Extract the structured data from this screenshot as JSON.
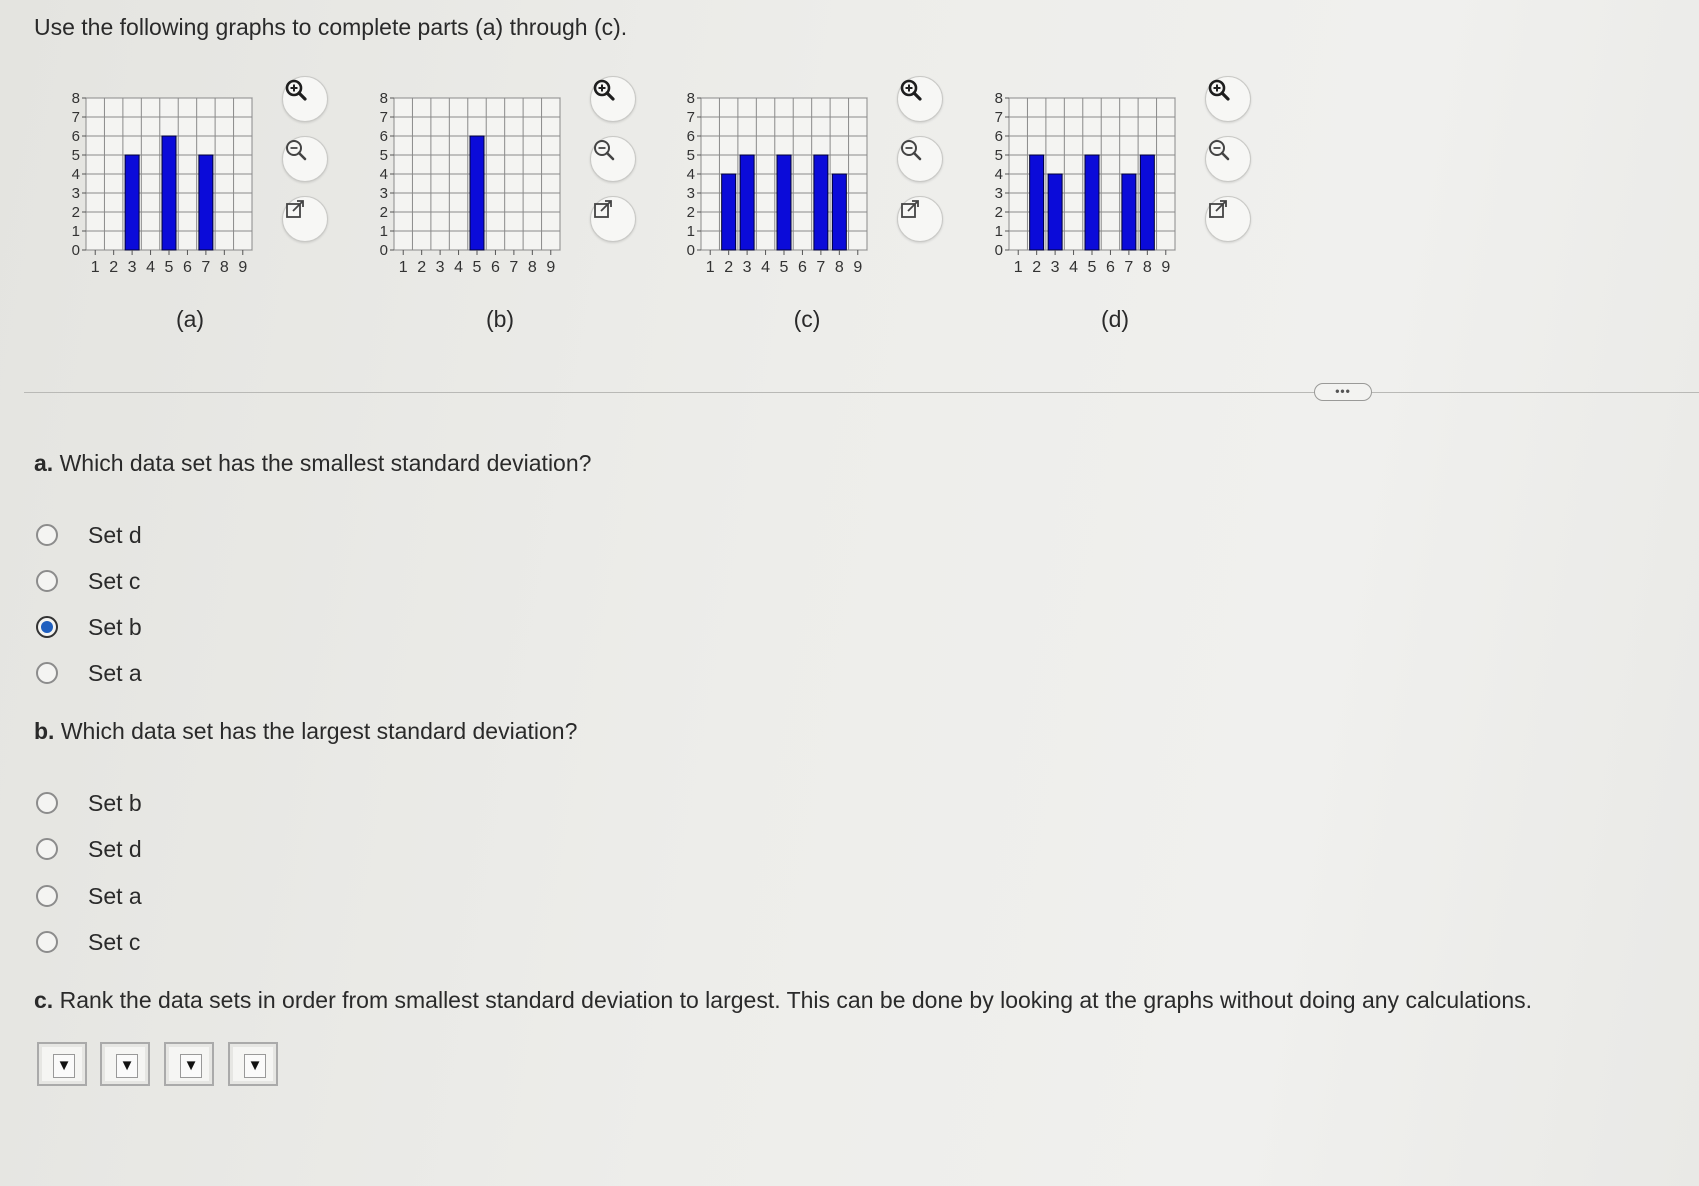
{
  "intro": "Use the following graphs to complete parts (a) through (c).",
  "chart_data": [
    {
      "type": "bar",
      "categories": [
        "1",
        "2",
        "3",
        "4",
        "5",
        "6",
        "7",
        "8",
        "9"
      ],
      "values": [
        0,
        0,
        5,
        0,
        6,
        0,
        5,
        0,
        0
      ],
      "y_ticks": [
        "0",
        "1",
        "2",
        "3",
        "4",
        "5",
        "6",
        "7",
        "8"
      ],
      "ylim": [
        0,
        8
      ],
      "grid": true,
      "caption": "(a)"
    },
    {
      "type": "bar",
      "categories": [
        "1",
        "2",
        "3",
        "4",
        "5",
        "6",
        "7",
        "8",
        "9"
      ],
      "values": [
        0,
        0,
        0,
        0,
        6,
        0,
        0,
        0,
        0
      ],
      "y_ticks": [
        "0",
        "1",
        "2",
        "3",
        "4",
        "5",
        "6",
        "7",
        "8"
      ],
      "ylim": [
        0,
        8
      ],
      "grid": true,
      "caption": "(b)"
    },
    {
      "type": "bar",
      "categories": [
        "1",
        "2",
        "3",
        "4",
        "5",
        "6",
        "7",
        "8",
        "9"
      ],
      "values": [
        0,
        4,
        5,
        0,
        5,
        0,
        5,
        4,
        0
      ],
      "y_ticks": [
        "0",
        "1",
        "2",
        "3",
        "4",
        "5",
        "6",
        "7",
        "8"
      ],
      "ylim": [
        0,
        8
      ],
      "grid": true,
      "caption": "(c)"
    },
    {
      "type": "bar",
      "categories": [
        "1",
        "2",
        "3",
        "4",
        "5",
        "6",
        "7",
        "8",
        "9"
      ],
      "values": [
        0,
        5,
        4,
        0,
        5,
        0,
        4,
        5,
        0
      ],
      "y_ticks": [
        "0",
        "1",
        "2",
        "3",
        "4",
        "5",
        "6",
        "7",
        "8"
      ],
      "ylim": [
        0,
        8
      ],
      "grid": true,
      "caption": "(d)"
    }
  ],
  "icons": [
    "zoom-in-icon",
    "zoom-out-icon",
    "open-external-icon"
  ],
  "more_button": "•••",
  "part_a": {
    "letter": "a.",
    "question": "Which data set has the smallest standard deviation?",
    "options": [
      "Set d",
      "Set c",
      "Set b",
      "Set a"
    ],
    "selected": "Set b"
  },
  "part_b": {
    "letter": "b.",
    "question": "Which data set has the largest standard deviation?",
    "options": [
      "Set b",
      "Set d",
      "Set a",
      "Set c"
    ],
    "selected": null
  },
  "part_c": {
    "letter": "c.",
    "question": "Rank the data sets in order from smallest standard deviation to largest. This can be done by looking at the graphs without doing any calculations.",
    "dropdowns": [
      "",
      "",
      "",
      ""
    ],
    "dropdown_arrow": "▼"
  },
  "colors": {
    "bar": "#0b0bd9",
    "bar_edge": "#000033",
    "grid": "#8a8a8a",
    "radio_selected": "#1f5fbf"
  }
}
